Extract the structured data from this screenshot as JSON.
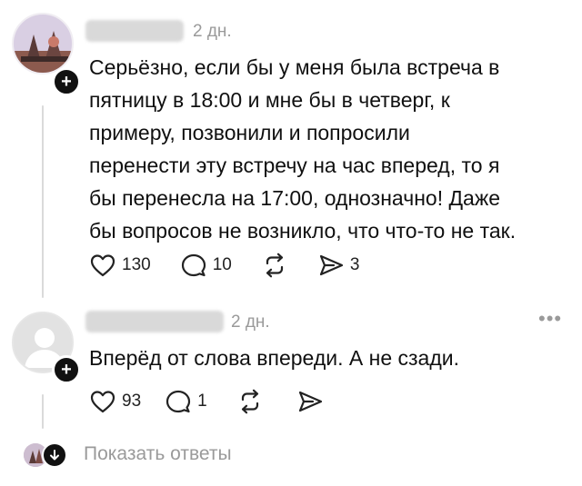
{
  "posts": [
    {
      "time": "2 дн.",
      "lines": [
        "Серьёзно, если бы у меня была встреча в",
        "пятницу в 18:00 и мне бы в четверг, к",
        "примеру, позвонили и попросили",
        "перенести эту встречу на час вперед, то я",
        "бы перенесла на 17:00, однозначно! Даже",
        "бы вопросов не возникло, что что-то не так."
      ],
      "likes": "130",
      "comments": "10",
      "shares": "3"
    },
    {
      "time": "2 дн.",
      "lines": [
        "Вперёд от слова впереди. А не сзади."
      ],
      "likes": "93",
      "comments": "1",
      "shares": ""
    }
  ],
  "show_replies_label": "Показать ответы",
  "icons": [
    "heart-icon",
    "comment-icon",
    "repost-icon",
    "share-icon",
    "more-icon",
    "plus-icon",
    "chevron-down-icon"
  ]
}
